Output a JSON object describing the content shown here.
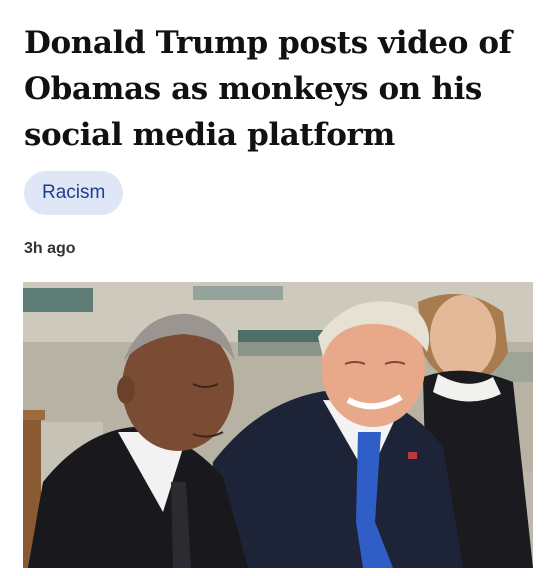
{
  "article": {
    "headline": "Donald Trump posts video of Obamas as monkeys on his social media platform",
    "tag_label": "Racism",
    "timestamp": "3h ago"
  },
  "image": {
    "subject_icon": "news-photo"
  },
  "colors": {
    "tag_background": "#dfe7f6",
    "tag_text": "#1e3f8f",
    "headline": "#111111"
  }
}
